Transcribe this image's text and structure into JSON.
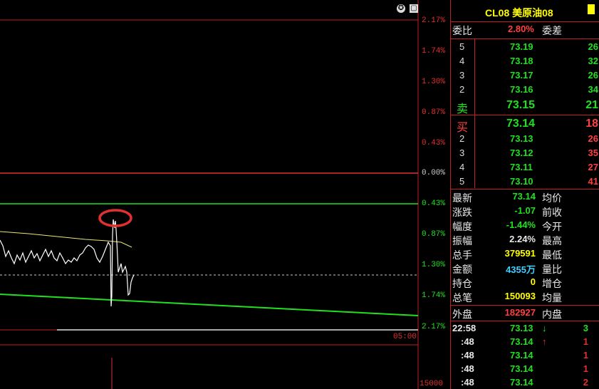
{
  "chart": {
    "pct_labels": [
      "2.17%",
      "1.74%",
      "1.30%",
      "0.87%",
      "0.43%",
      "0.00%",
      "0.43%",
      "0.87%",
      "1.30%",
      "1.74%",
      "2.17%"
    ],
    "time_label": "05:00",
    "volume_label": "15000",
    "colors": {
      "up": "#e03030",
      "down": "#20e020",
      "price": "#ffffff",
      "avg": "#e8e870"
    }
  },
  "header": {
    "title": "CL08 美原油08"
  },
  "ratio": {
    "label": "委比",
    "value": "2.80%",
    "diff_label": "委差"
  },
  "asks": [
    {
      "level": "5",
      "price": "73.19",
      "vol": "26"
    },
    {
      "level": "4",
      "price": "73.18",
      "vol": "32"
    },
    {
      "level": "3",
      "price": "73.17",
      "vol": "26"
    },
    {
      "level": "2",
      "price": "73.16",
      "vol": "34"
    },
    {
      "level": "卖",
      "price": "73.15",
      "vol": "21"
    }
  ],
  "bids": [
    {
      "level": "买",
      "price": "73.14",
      "vol": "18"
    },
    {
      "level": "2",
      "price": "73.13",
      "vol": "26"
    },
    {
      "level": "3",
      "price": "73.12",
      "vol": "35"
    },
    {
      "level": "4",
      "price": "73.11",
      "vol": "27"
    },
    {
      "level": "5",
      "price": "73.10",
      "vol": "41"
    }
  ],
  "stats": [
    {
      "label": "最新",
      "value": "73.14",
      "color": "#20e020",
      "right": "均价"
    },
    {
      "label": "涨跌",
      "value": "-1.07",
      "color": "#20e020",
      "right": "前收"
    },
    {
      "label": "幅度",
      "value": "-1.44%",
      "color": "#20e020",
      "right": "今开"
    },
    {
      "label": "振幅",
      "value": "2.24%",
      "color": "#e8e8e8",
      "right": "最高"
    },
    {
      "label": "总手",
      "value": "379591",
      "color": "#ffff00",
      "right": "最低"
    },
    {
      "label": "金额",
      "value": "4355万",
      "color": "#40d0ff",
      "right": "量比"
    },
    {
      "label": "持仓",
      "value": "0",
      "color": "#ffff00",
      "right": "增仓"
    },
    {
      "label": "总笔",
      "value": "150093",
      "color": "#ffff00",
      "right": "均量"
    }
  ],
  "outer": {
    "label": "外盘",
    "value": "182927",
    "right": "内盘"
  },
  "ticks": [
    {
      "time": "22:58",
      "price": "73.13",
      "arrow": "↓",
      "arrow_color": "#20e020",
      "vol": "3",
      "vol_color": "#20e020"
    },
    {
      "time": ":48",
      "price": "73.14",
      "arrow": "↑",
      "arrow_color": "#e03030",
      "vol": "1",
      "vol_color": "#e03030"
    },
    {
      "time": ":48",
      "price": "73.14",
      "arrow": "",
      "arrow_color": "#e03030",
      "vol": "1",
      "vol_color": "#e03030"
    },
    {
      "time": ":48",
      "price": "73.14",
      "arrow": "",
      "arrow_color": "#e03030",
      "vol": "1",
      "vol_color": "#e03030"
    },
    {
      "time": ":48",
      "price": "73.14",
      "arrow": "",
      "arrow_color": "#e03030",
      "vol": "2",
      "vol_color": "#e03030"
    }
  ]
}
